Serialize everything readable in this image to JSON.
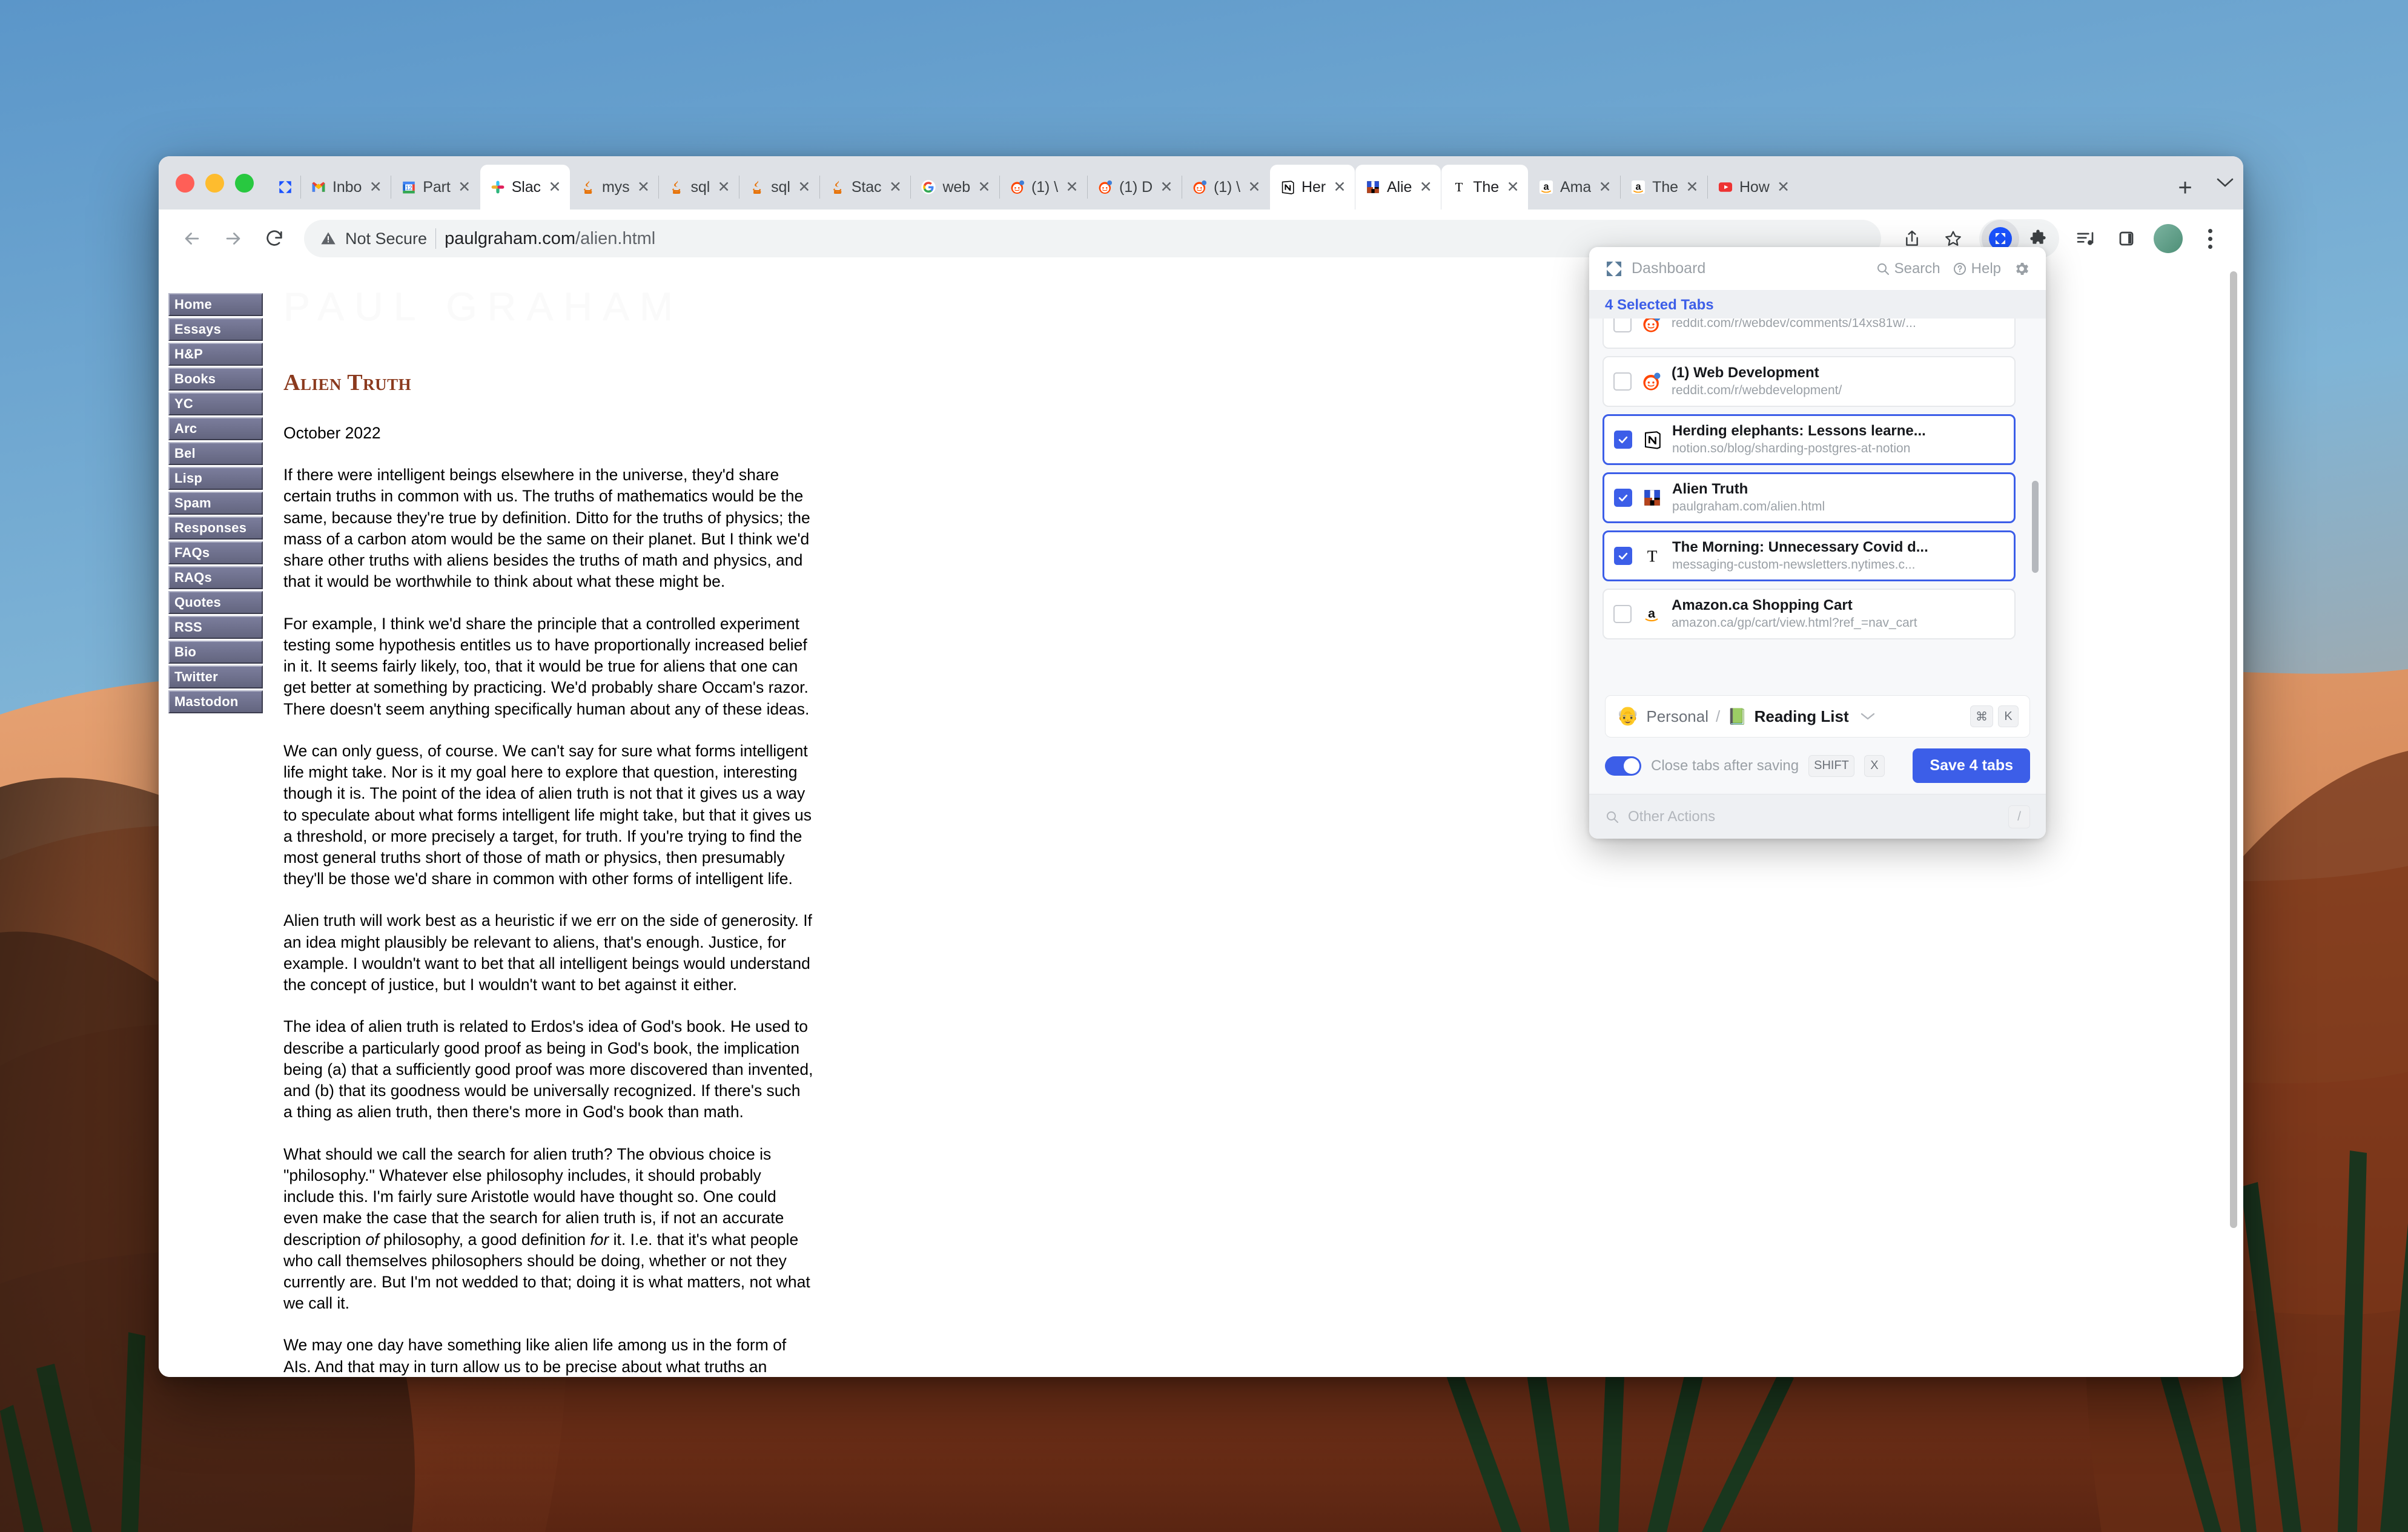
{
  "browser": {
    "traffic_lights": [
      "close",
      "minimize",
      "maximize"
    ],
    "tabs": [
      {
        "title": "",
        "favicon": "partizion-logo",
        "active": false,
        "pinned": true,
        "show_close": false
      },
      {
        "title": "Inbo",
        "favicon": "gmail-icon",
        "active": false
      },
      {
        "title": "Part",
        "favicon": "google-calendar-icon",
        "active": false
      },
      {
        "title": "Slac",
        "favicon": "slack-icon",
        "active": true
      },
      {
        "title": "mys",
        "favicon": "java-icon",
        "active": false
      },
      {
        "title": "sql",
        "favicon": "java-icon",
        "active": false
      },
      {
        "title": "sql",
        "favicon": "java-icon",
        "active": false
      },
      {
        "title": "Stac",
        "favicon": "java-icon",
        "active": false
      },
      {
        "title": "web",
        "favicon": "google-icon",
        "active": false
      },
      {
        "title": "(1) \\",
        "favicon": "reddit-icon",
        "active": false
      },
      {
        "title": "(1) D",
        "favicon": "reddit-icon",
        "active": false
      },
      {
        "title": "(1) \\",
        "favicon": "reddit-icon",
        "active": false
      },
      {
        "title": "Her",
        "favicon": "notion-icon",
        "active": true
      },
      {
        "title": "Alie",
        "favicon": "paulgraham-icon",
        "active": true
      },
      {
        "title": "The",
        "favicon": "nytimes-icon",
        "active": true
      },
      {
        "title": "Ama",
        "favicon": "amazon-icon",
        "active": false
      },
      {
        "title": "The",
        "favicon": "amazon-icon",
        "active": false
      },
      {
        "title": "How",
        "favicon": "youtube-icon",
        "active": false
      }
    ],
    "new_tab_label": "+",
    "close_label": "✕",
    "toolbar": {
      "back": "back-arrow",
      "forward": "forward-arrow",
      "reload": "reload-arrow",
      "security_label": "Not Secure",
      "url_host": "paulgraham.com",
      "url_path": "/alien.html",
      "share": "share-icon",
      "bookmark": "star-icon",
      "extension_active": "partizion-extension",
      "extensions": "puzzle-icon",
      "media": "media-icon",
      "side_panel": "side-panel-icon",
      "profile": "profile-avatar",
      "menu": "three-dot-menu"
    }
  },
  "webpage": {
    "wordmark": "PAUL GRAHAM",
    "title": "Alien Truth",
    "date": "October 2022",
    "nav": [
      {
        "label": "Home"
      },
      {
        "label": "Essays"
      },
      {
        "label": "H&P"
      },
      {
        "label": "Books"
      },
      {
        "label": "YC"
      },
      {
        "label": "Arc"
      },
      {
        "label": "Bel"
      },
      {
        "label": "Lisp"
      },
      {
        "label": "Spam"
      },
      {
        "label": "Responses"
      },
      {
        "label": "FAQs"
      },
      {
        "label": "RAQs"
      },
      {
        "label": "Quotes"
      },
      {
        "label": "RSS"
      },
      {
        "label": "Bio"
      },
      {
        "label": "Twitter"
      },
      {
        "label": "Mastodon"
      }
    ],
    "paragraphs": [
      "If there were intelligent beings elsewhere in the universe, they'd share certain truths in common with us. The truths of mathematics would be the same, because they're true by definition. Ditto for the truths of physics; the mass of a carbon atom would be the same on their planet. But I think we'd share other truths with aliens besides the truths of math and physics, and that it would be worthwhile to think about what these might be.",
      "For example, I think we'd share the principle that a controlled experiment testing some hypothesis entitles us to have proportionally increased belief in it. It seems fairly likely, too, that it would be true for aliens that one can get better at something by practicing. We'd probably share Occam's razor. There doesn't seem anything specifically human about any of these ideas.",
      "We can only guess, of course. We can't say for sure what forms intelligent life might take. Nor is it my goal here to explore that question, interesting though it is. The point of the idea of alien truth is not that it gives us a way to speculate about what forms intelligent life might take, but that it gives us a threshold, or more precisely a target, for truth. If you're trying to find the most general truths short of those of math or physics, then presumably they'll be those we'd share in common with other forms of intelligent life.",
      "Alien truth will work best as a heuristic if we err on the side of generosity. If an idea might plausibly be relevant to aliens, that's enough. Justice, for example. I wouldn't want to bet that all intelligent beings would understand the concept of justice, but I wouldn't want to bet against it either.",
      "The idea of alien truth is related to Erdos's idea of God's book. He used to describe a particularly good proof as being in God's book, the implication being (a) that a sufficiently good proof was more discovered than invented, and (b) that its goodness would be universally recognized. If there's such a thing as alien truth, then there's more in God's book than math.",
      "What should we call the search for alien truth? The obvious choice is \"philosophy.\" Whatever else philosophy includes, it should probably include this. I'm fairly sure Aristotle would have thought so. One could even make the case that the search for alien truth is, if not an accurate description <em>of</em> philosophy, a good definition <em>for</em> it. I.e. that it's what people who call themselves philosophers should be doing, whether or not they currently are. But I'm not wedded to that; doing it is what matters, not what we call it.",
      "We may one day have something like alien life among us in the form of AIs. And that may in turn allow us to be precise about what truths an intelligent being would have to share with us. We"
    ]
  },
  "extension_popup": {
    "header": {
      "logo": "partizion-logo",
      "dashboard_label": "Dashboard",
      "search_label": "Search",
      "help_label": "Help",
      "settings": "gear-icon"
    },
    "selected_count_label": "4 Selected Tabs",
    "partial_top_row": {
      "url": "reddit.com/r/webdev/comments/14xs81w/..."
    },
    "tabs": [
      {
        "title": "(1) Web Development",
        "url": "reddit.com/r/webdevelopment/",
        "favicon": "reddit-icon",
        "selected": false
      },
      {
        "title": "Herding elephants: Lessons learne...",
        "url": "notion.so/blog/sharding-postgres-at-notion",
        "favicon": "notion-icon",
        "selected": true
      },
      {
        "title": "Alien Truth",
        "url": "paulgraham.com/alien.html",
        "favicon": "paulgraham-icon",
        "selected": true
      },
      {
        "title": "The Morning: Unnecessary Covid d...",
        "url": "messaging-custom-newsletters.nytimes.c...",
        "favicon": "nytimes-icon",
        "selected": true
      },
      {
        "title": "Amazon.ca Shopping Cart",
        "url": "amazon.ca/gp/cart/view.html?ref_=nav_cart",
        "favicon": "amazon-icon",
        "selected": false
      }
    ],
    "destination": {
      "avatar": "👴",
      "space": "Personal",
      "separator": "/",
      "folder_icon": "📗",
      "folder": "Reading List",
      "chevron": "chevron-down-icon",
      "shortcut_keys": [
        "⌘",
        "K"
      ]
    },
    "close_tabs_toggle": {
      "label": "Close tabs after saving",
      "enabled": true,
      "shortcut_keys": [
        "SHIFT",
        "X"
      ]
    },
    "save_button_label": "Save 4 tabs",
    "other_actions": {
      "placeholder": "Other Actions",
      "shortcut_key": "/"
    }
  },
  "colors": {
    "accent_blue": "#3c5ee8",
    "tabstrip_grey": "#dee1e6",
    "pg_title_brown": "#8b3a1e",
    "pg_nav_slate": "#6d6f8e"
  }
}
